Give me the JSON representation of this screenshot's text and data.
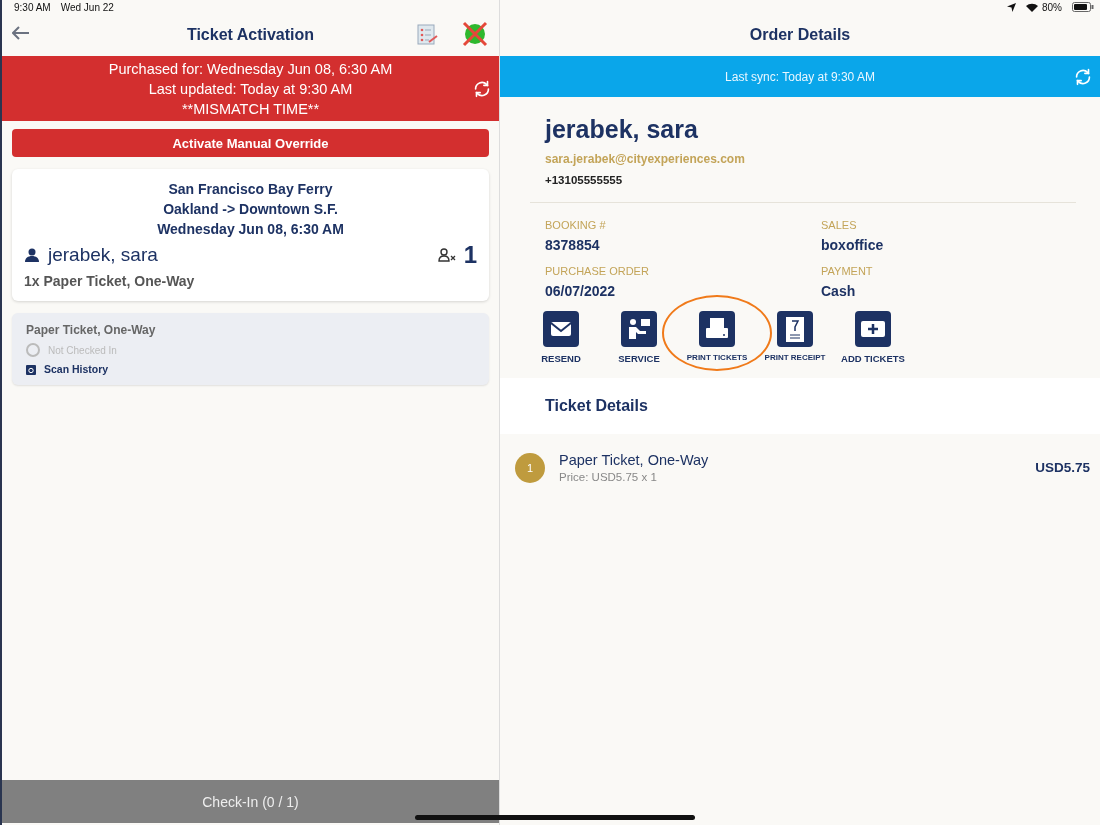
{
  "status_bar": {
    "time": "9:30 AM",
    "date": "Wed Jun 22",
    "battery": "80%"
  },
  "left": {
    "title": "Ticket Activation",
    "alert": {
      "lines": [
        "Purchased for: Wednesday Jun 08, 6:30 AM",
        "Last updated: Today at 9:30 AM",
        "**MISMATCH TIME**"
      ]
    },
    "override_button": "Activate Manual Override",
    "trip": {
      "lines": [
        "San Francisco Bay Ferry",
        "Oakland -> Downtown S.F.",
        "Wednesday Jun 08, 6:30 AM"
      ],
      "guest": "jerabek, sara",
      "count": "1",
      "tickets": "1x Paper Ticket, One-Way"
    },
    "ticket": {
      "name": "Paper Ticket, One-Way",
      "status": "Not Checked In",
      "checked": false,
      "history": "Scan History"
    },
    "checkin_button": "Check-In (0 / 1)"
  },
  "right": {
    "title": "Order Details",
    "sync": "Last sync: Today at 9:30 AM",
    "customer": {
      "name": "jerabek, sara",
      "email": "sara.jerabek@cityexperiences.com",
      "phone": "+13105555555"
    },
    "fields": [
      {
        "label": "BOOKING #",
        "value": "8378854"
      },
      {
        "label": "SALES",
        "value": "boxoffice"
      },
      {
        "label": "PURCHASE ORDER",
        "value": "06/07/2022"
      },
      {
        "label": "PAYMENT",
        "value": "Cash"
      }
    ],
    "actions": [
      {
        "kind": "mail",
        "label": "RESEND",
        "selected": false
      },
      {
        "kind": "service",
        "label": "SERVICE",
        "selected": false
      },
      {
        "kind": "printer",
        "label": "PRINT TICKETS",
        "selected": true
      },
      {
        "kind": "receipt",
        "label": "PRINT RECEIPT",
        "selected": false
      },
      {
        "kind": "add",
        "label": "ADD TICKETS",
        "selected": false
      }
    ],
    "ticket_details": {
      "heading": "Ticket Details",
      "items": [
        {
          "index": "1",
          "name": "Paper Ticket, One-Way",
          "price": "Price: USD5.75 x 1",
          "total": "USD5.75"
        }
      ]
    }
  }
}
